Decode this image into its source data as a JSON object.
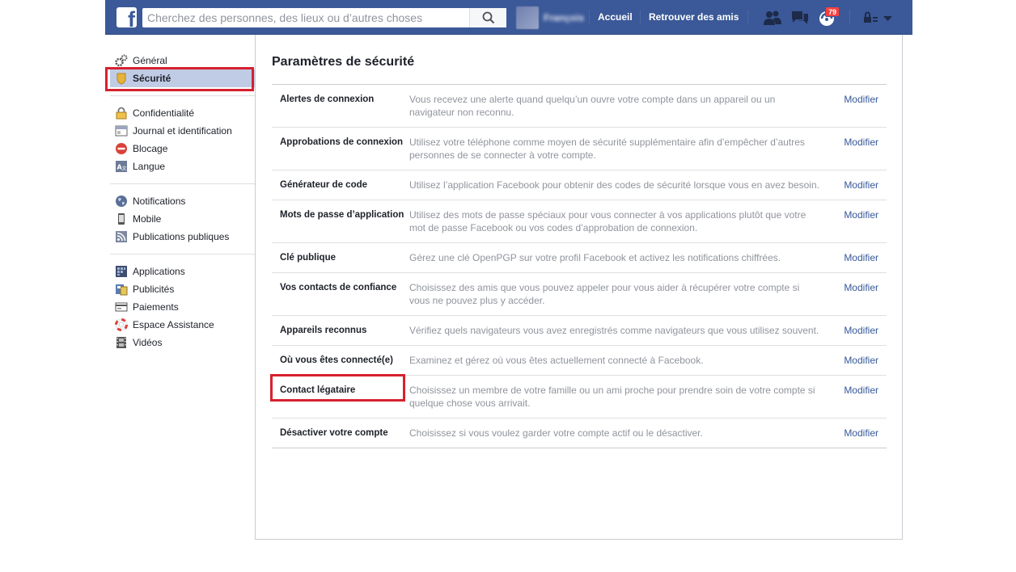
{
  "header": {
    "search_placeholder": "Cherchez des personnes, des lieux ou d’autres choses",
    "profile_name": "François",
    "nav": [
      "Accueil",
      "Retrouver des amis"
    ],
    "notifications_count": "79",
    "icons": [
      "friend-requests-icon",
      "messages-icon",
      "notifications-icon",
      "privacy-shortcuts-icon",
      "account-dropdown-icon"
    ]
  },
  "sidebar": {
    "groups": [
      [
        {
          "label": "Général",
          "icon": "gear-icon"
        },
        {
          "label": "Sécurité",
          "icon": "shield-icon",
          "active": true
        }
      ],
      [
        {
          "label": "Confidentialité",
          "icon": "lock-icon"
        },
        {
          "label": "Journal et identification",
          "icon": "timeline-icon"
        },
        {
          "label": "Blocage",
          "icon": "block-icon"
        },
        {
          "label": "Langue",
          "icon": "language-icon"
        }
      ],
      [
        {
          "label": "Notifications",
          "icon": "globe-icon"
        },
        {
          "label": "Mobile",
          "icon": "mobile-icon"
        },
        {
          "label": "Publications publiques",
          "icon": "rss-icon"
        }
      ],
      [
        {
          "label": "Applications",
          "icon": "apps-icon"
        },
        {
          "label": "Publicités",
          "icon": "ads-icon"
        },
        {
          "label": "Paiements",
          "icon": "card-icon"
        },
        {
          "label": "Espace Assistance",
          "icon": "lifebuoy-icon"
        },
        {
          "label": "Vidéos",
          "icon": "film-icon"
        }
      ]
    ]
  },
  "main": {
    "title": "Paramètres de sécurité",
    "edit_label": "Modifier",
    "rows": [
      {
        "label": "Alertes de connexion",
        "desc": "Vous recevez une alerte quand quelqu’un ouvre votre compte dans un appareil ou un navigateur non reconnu."
      },
      {
        "label": "Approbations de connexion",
        "desc": "Utilisez votre téléphone comme moyen de sécurité supplémentaire afin d’empêcher d’autres personnes de se connecter à votre compte."
      },
      {
        "label": "Générateur de code",
        "desc": "Utilisez l’application Facebook pour obtenir des codes de sécurité lorsque vous en avez besoin."
      },
      {
        "label": "Mots de passe d’application",
        "desc": "Utilisez des mots de passe spéciaux pour vous connecter à vos applications plutôt que votre mot de passe Facebook ou vos codes d’approbation de connexion."
      },
      {
        "label": "Clé publique",
        "desc": "Gérez une clé OpenPGP sur votre profil Facebook et activez les notifications chiffrées."
      },
      {
        "label": "Vos contacts de confiance",
        "desc": "Choisissez des amis que vous pouvez appeler pour vous aider à récupérer votre compte si vous ne pouvez plus y accéder."
      },
      {
        "label": "Appareils reconnus",
        "desc": "Vérifiez quels navigateurs vous avez enregistrés comme navigateurs que vous utilisez souvent."
      },
      {
        "label": "Où vous êtes connecté(e)",
        "desc": "Examinez et gérez où vous êtes actuellement connecté à Facebook."
      },
      {
        "label": "Contact légataire",
        "desc": "Choisissez un membre de votre famille ou un ami proche pour prendre soin de votre compte si quelque chose vous arrivait."
      },
      {
        "label": "Désactiver votre compte",
        "desc": "Choisissez si vous voulez garder votre compte actif ou le désactiver."
      }
    ]
  },
  "colors": {
    "brand": "#3b5998",
    "highlight": "#d6212f",
    "link": "#365899"
  }
}
